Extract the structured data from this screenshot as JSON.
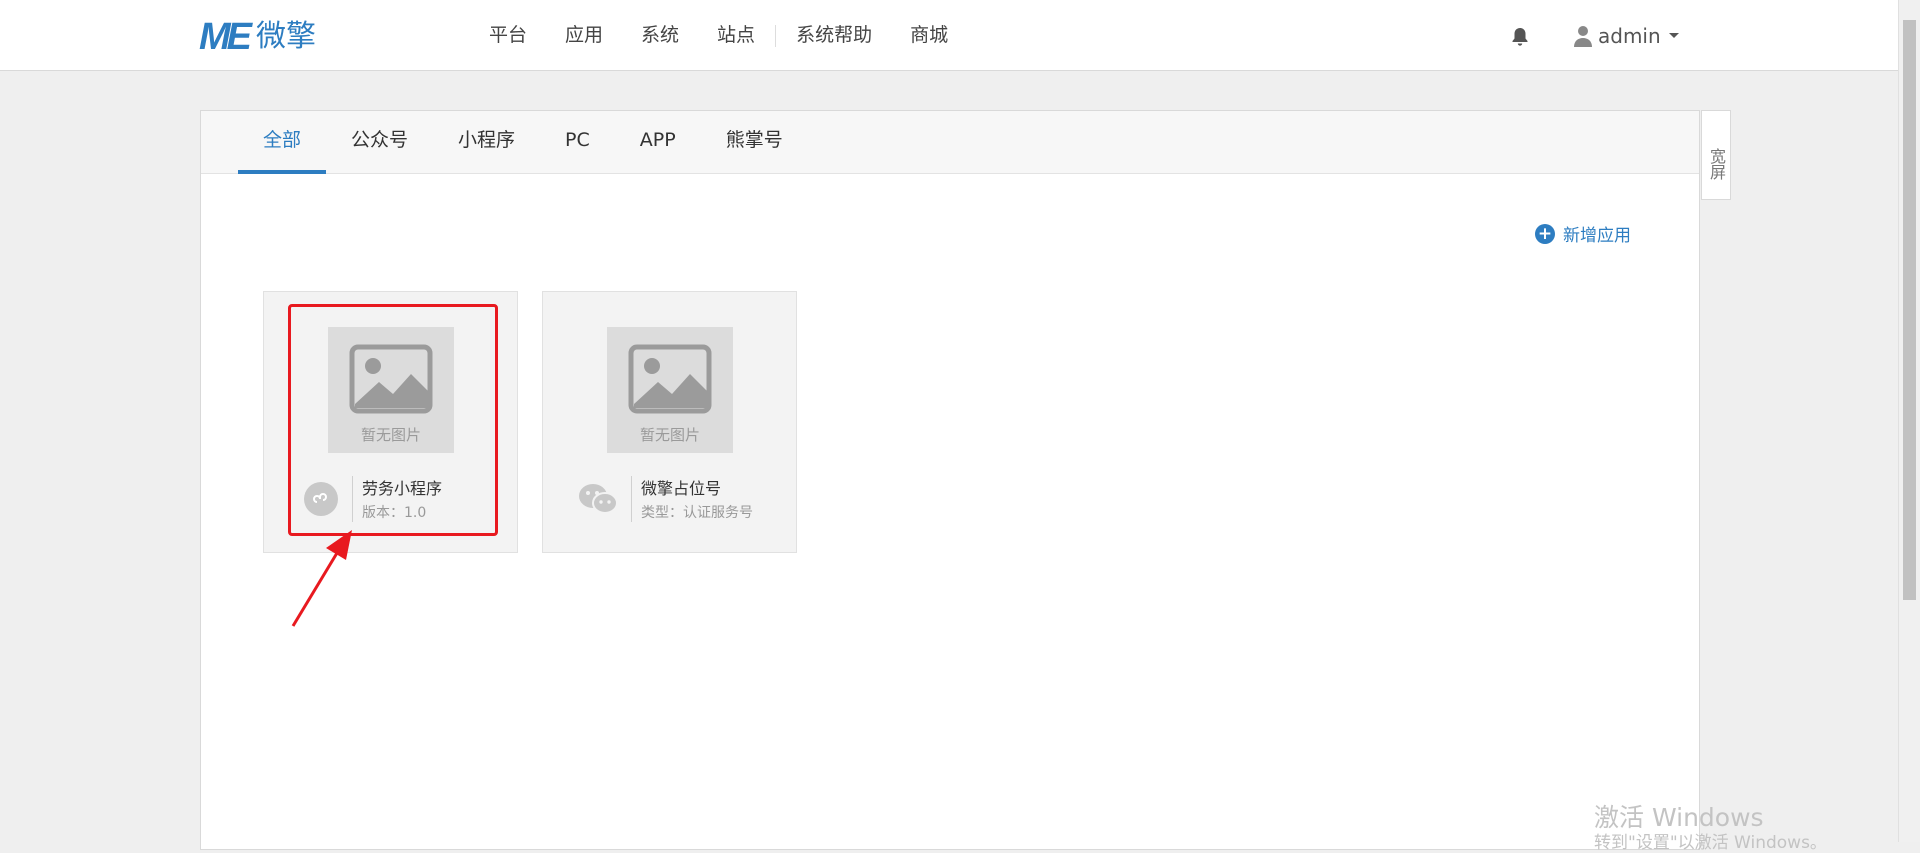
{
  "brand": {
    "logo_mark": "ME",
    "logo_text": "微擎"
  },
  "nav": {
    "items": [
      "平台",
      "应用",
      "系统",
      "站点",
      "系统帮助",
      "商城"
    ]
  },
  "user": {
    "name": "admin"
  },
  "tabs": {
    "items": [
      "全部",
      "公众号",
      "小程序",
      "PC",
      "APP",
      "熊掌号"
    ],
    "active": "全部"
  },
  "wide_button": {
    "label": "宽屏"
  },
  "add_app": {
    "label": "新增应用"
  },
  "cards": [
    {
      "thumb_text": "暂无图片",
      "name": "劳务小程序",
      "meta": "版本：1.0",
      "icon": "mini-program-icon"
    },
    {
      "thumb_text": "暂无图片",
      "name": "微擎占位号",
      "meta": "类型：认证服务号",
      "icon": "wechat-icon"
    }
  ],
  "watermark": {
    "title": "激活 Windows",
    "subtitle": "转到\"设置\"以激活 Windows。"
  },
  "colors": {
    "accent": "#2d7dc1",
    "highlight": "#e8191f",
    "topbar_bg": "#ffffff",
    "page_bg": "#efefef"
  }
}
